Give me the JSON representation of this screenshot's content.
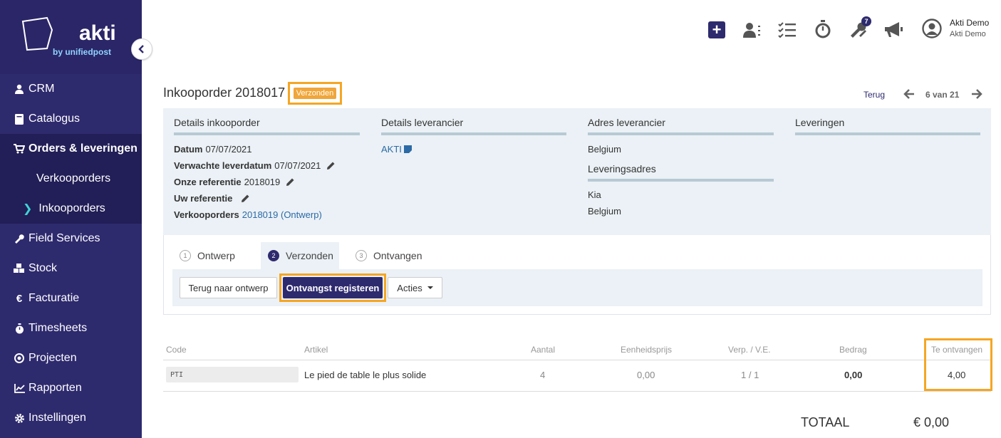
{
  "brand": {
    "name": "akti",
    "tagline": "by unifiedpost"
  },
  "sidebar": {
    "items": [
      {
        "label": "CRM",
        "icon": "user-icon"
      },
      {
        "label": "Catalogus",
        "icon": "book-icon"
      },
      {
        "label": "Orders & leveringen",
        "icon": "cart-icon",
        "active": true
      },
      {
        "label": "Verkooporders",
        "sub": true
      },
      {
        "label": "Inkooporders",
        "sub": true,
        "current": true
      },
      {
        "label": "Field Services",
        "icon": "wrench-icon"
      },
      {
        "label": "Stock",
        "icon": "cubes-icon"
      },
      {
        "label": "Facturatie",
        "icon": "euro-icon"
      },
      {
        "label": "Timesheets",
        "icon": "stopwatch-icon"
      },
      {
        "label": "Projecten",
        "icon": "target-icon"
      },
      {
        "label": "Rapporten",
        "icon": "chart-icon"
      },
      {
        "label": "Instellingen",
        "icon": "gear-icon"
      }
    ]
  },
  "topbar": {
    "notification_count": "7",
    "user_name": "Akti Demo",
    "user_company": "Akti Demo"
  },
  "header": {
    "title": "Inkooporder 2018017",
    "status": "Verzonden",
    "back_label": "Terug",
    "pager": "6 van 21"
  },
  "details": {
    "order": {
      "heading": "Details inkooporder",
      "datum_label": "Datum",
      "datum_value": "07/07/2021",
      "delivery_label": "Verwachte leverdatum",
      "delivery_value": "07/07/2021",
      "our_ref_label": "Onze referentie",
      "our_ref_value": "2018019",
      "your_ref_label": "Uw referentie",
      "sales_label": "Verkooporders",
      "sales_value": "2018019 (Ontwerp)"
    },
    "supplier": {
      "heading": "Details leverancier",
      "name": "AKTI"
    },
    "address": {
      "heading": "Adres leverancier",
      "country": "Belgium",
      "delivery_heading": "Leveringsadres",
      "delivery_line1": "Kia",
      "delivery_line2": "Belgium"
    },
    "deliveries": {
      "heading": "Leveringen"
    }
  },
  "steps": [
    {
      "num": "1",
      "label": "Ontwerp"
    },
    {
      "num": "2",
      "label": "Verzonden"
    },
    {
      "num": "3",
      "label": "Ontvangen"
    }
  ],
  "actions": {
    "back_to_draft": "Terug naar ontwerp",
    "register_receipt": "Ontvangst registeren",
    "actions": "Acties"
  },
  "table": {
    "headers": {
      "code": "Code",
      "article": "Artikel",
      "qty": "Aantal",
      "unit_price": "Eenheidsprijs",
      "pack": "Verp. / V.E.",
      "amount": "Bedrag",
      "to_receive": "Te ontvangen"
    },
    "rows": [
      {
        "code": "PTI",
        "article": "Le pied de table le plus solide",
        "qty": "4",
        "unit_price": "0,00",
        "pack": "1 / 1",
        "amount": "0,00",
        "to_receive": "4,00"
      }
    ]
  },
  "totals": {
    "label": "TOTAAL",
    "value": "€ 0,00"
  },
  "colors": {
    "sidebar": "#2e2a6e",
    "accent": "#40d3d6",
    "highlight": "#f5a623",
    "status": "#f0a63a"
  }
}
